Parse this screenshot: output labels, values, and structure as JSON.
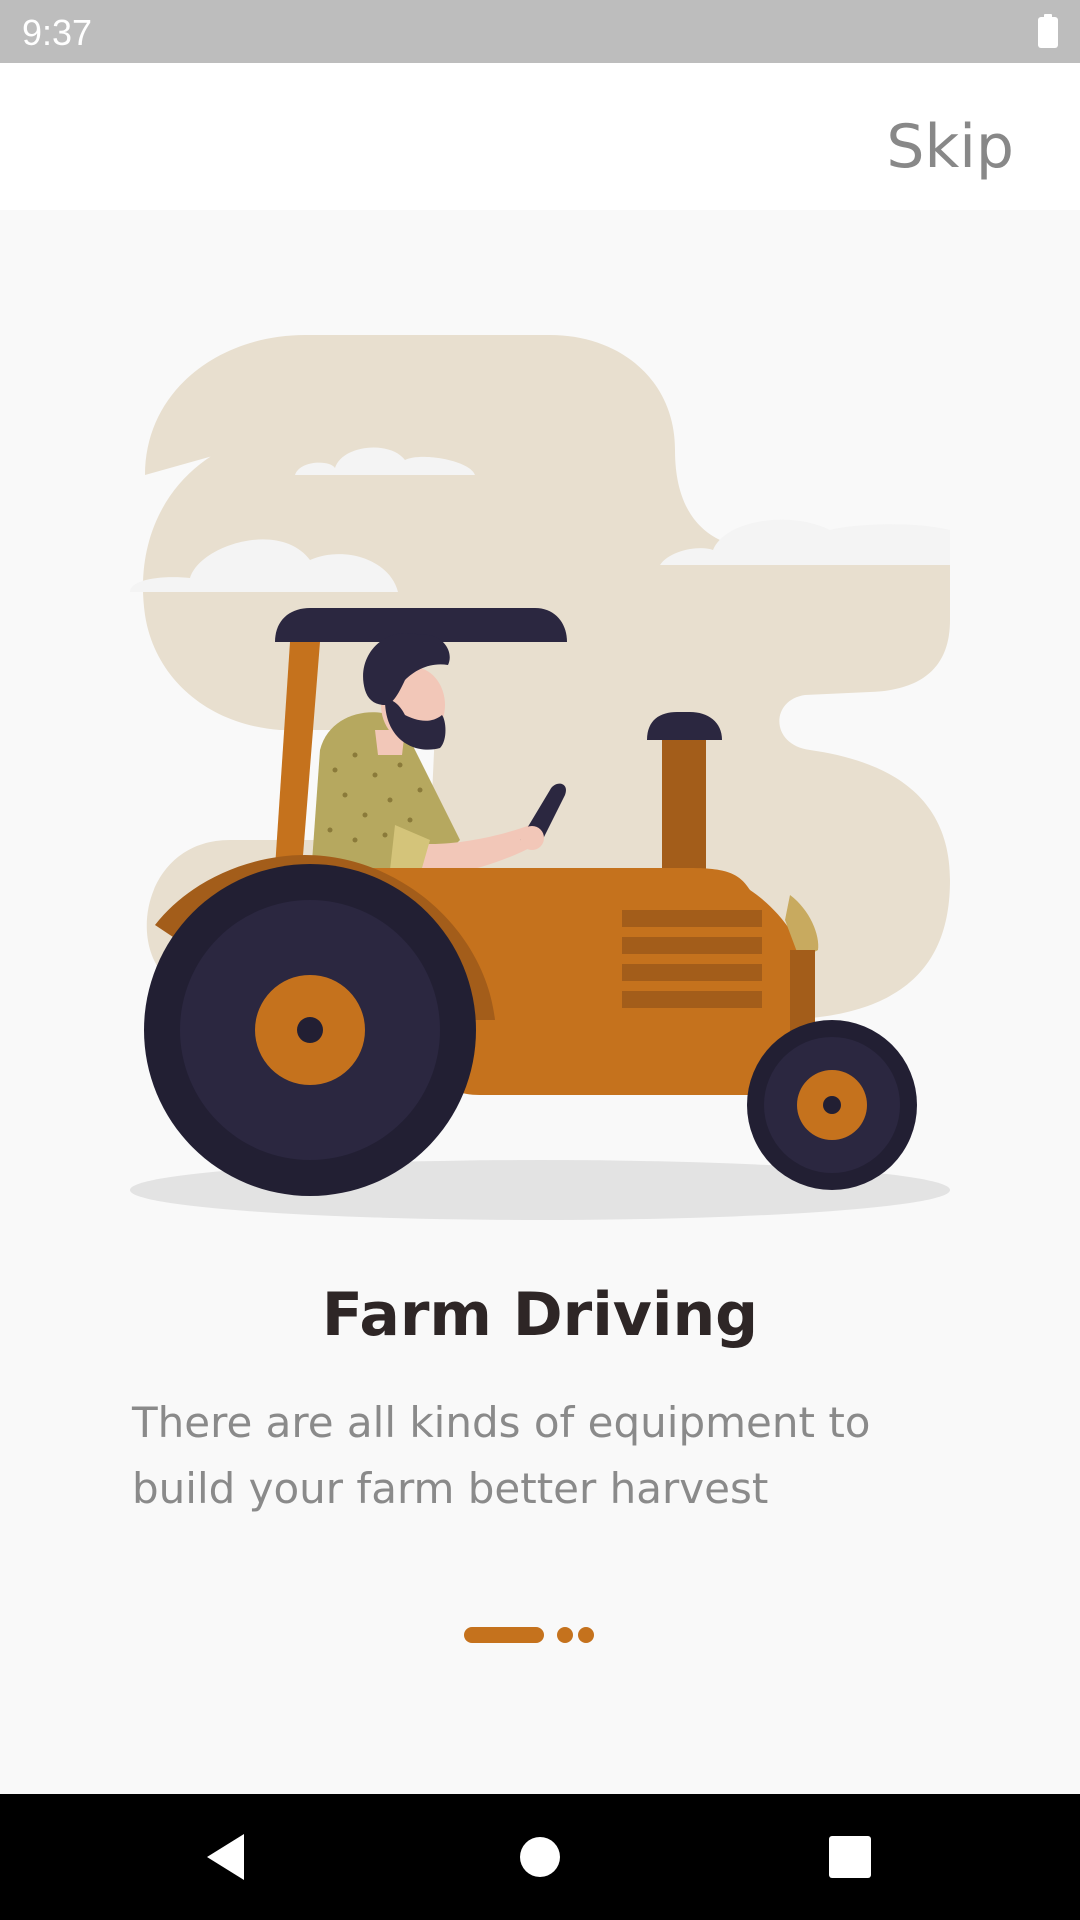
{
  "status_bar": {
    "time": "9:37",
    "battery_icon": "battery-full-icon"
  },
  "app_bar": {
    "skip_label": "Skip"
  },
  "onboarding": {
    "illustration_icon": "tractor-driver-illustration",
    "title": "Farm Driving",
    "description": "There are all kinds of equipment to build your farm better harvest",
    "page_indicator": {
      "current_page": 1,
      "total_pages": 3
    }
  },
  "colors": {
    "accent": "#c5721d",
    "title": "#2e2626",
    "description": "#8a8a8a",
    "status_bar": "#bdbdbd",
    "background": "#f9f9f9"
  },
  "navigation_bar": {
    "back_icon": "back-triangle-icon",
    "home_icon": "home-circle-icon",
    "recents_icon": "recents-square-icon"
  }
}
